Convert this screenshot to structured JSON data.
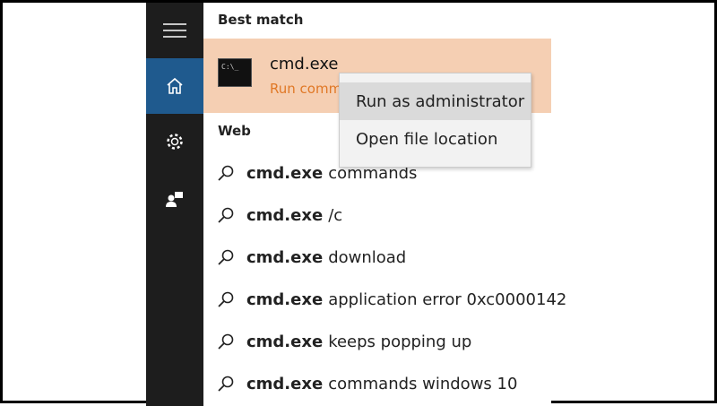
{
  "sidebar": {
    "items": [
      "menu-icon",
      "home-icon",
      "settings-icon",
      "feedback-icon"
    ],
    "active_color": "#1f5a8e"
  },
  "best_match": {
    "header": "Best match",
    "title": "cmd.exe",
    "subtitle": "Run command",
    "icon_text": "C:\\_",
    "highlight_color": "#f5cfb3"
  },
  "web": {
    "header": "Web",
    "results": [
      {
        "bold": "cmd.exe",
        "rest": "commands"
      },
      {
        "bold": "cmd.exe",
        "rest": "/c"
      },
      {
        "bold": "cmd.exe",
        "rest": "download"
      },
      {
        "bold": "cmd.exe",
        "rest": "application error 0xc0000142"
      },
      {
        "bold": "cmd.exe",
        "rest": "keeps popping up"
      },
      {
        "bold": "cmd.exe",
        "rest": "commands windows 10"
      }
    ]
  },
  "context_menu": {
    "items": [
      "Run as administrator",
      "Open file location"
    ]
  }
}
